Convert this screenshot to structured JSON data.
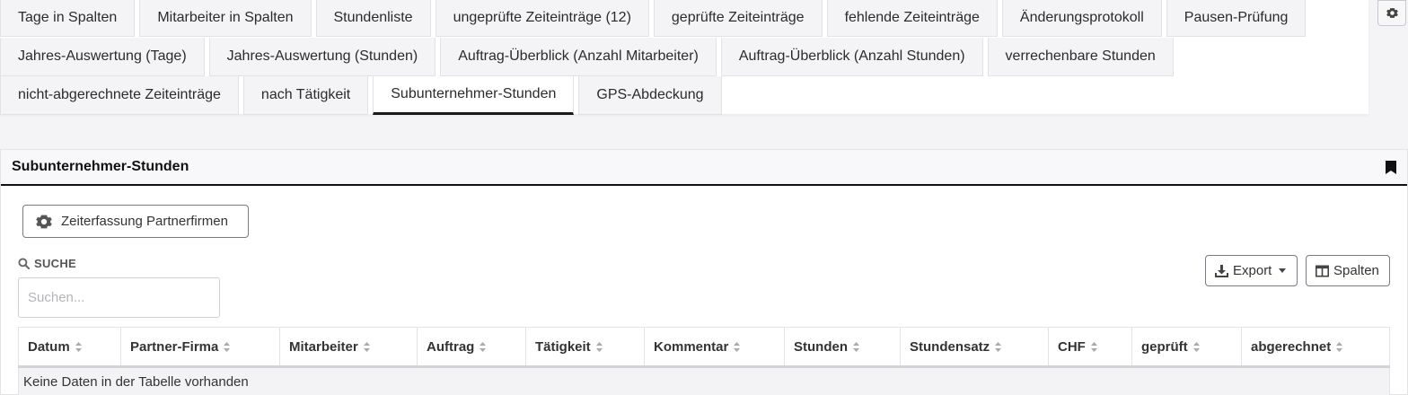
{
  "tabs": {
    "row1": [
      "Tage in Spalten",
      "Mitarbeiter in Spalten",
      "Stundenliste",
      "ungeprüfte Zeiteinträge (12)",
      "geprüfte Zeiteinträge",
      "fehlende Zeiteinträge",
      "Änderungsprotokoll",
      "Pausen-Prüfung"
    ],
    "row2": [
      "Jahres-Auswertung (Tage)",
      "Jahres-Auswertung (Stunden)",
      "Auftrag-Überblick (Anzahl Mitarbeiter)",
      "Auftrag-Überblick (Anzahl Stunden)",
      "verrechenbare Stunden"
    ],
    "row3": [
      "nicht-abgerechnete Zeiteinträge",
      "nach Tätigkeit",
      "Subunternehmer-Stunden",
      "GPS-Abdeckung"
    ],
    "active": "Subunternehmer-Stunden"
  },
  "panel": {
    "title": "Subunternehmer-Stunden",
    "partner_button": "Zeiterfassung Partnerfirmen",
    "search_label": "SUCHE",
    "search_placeholder": "Suchen...",
    "export_label": "Export",
    "columns_label": "Spalten"
  },
  "table": {
    "columns": [
      "Datum",
      "Partner-Firma",
      "Mitarbeiter",
      "Auftrag",
      "Tätigkeit",
      "Kommentar",
      "Stunden",
      "Stundensatz",
      "CHF",
      "geprüft",
      "abgerechnet"
    ],
    "empty_message": "Keine Daten in der Tabelle vorhanden"
  },
  "icons": {
    "settings": "gear-icon",
    "bookmark": "bookmark-icon",
    "partner": "gear-icon",
    "search": "search-icon",
    "export": "download-icon",
    "columns": "columns-icon",
    "sort": "sort-icon"
  }
}
